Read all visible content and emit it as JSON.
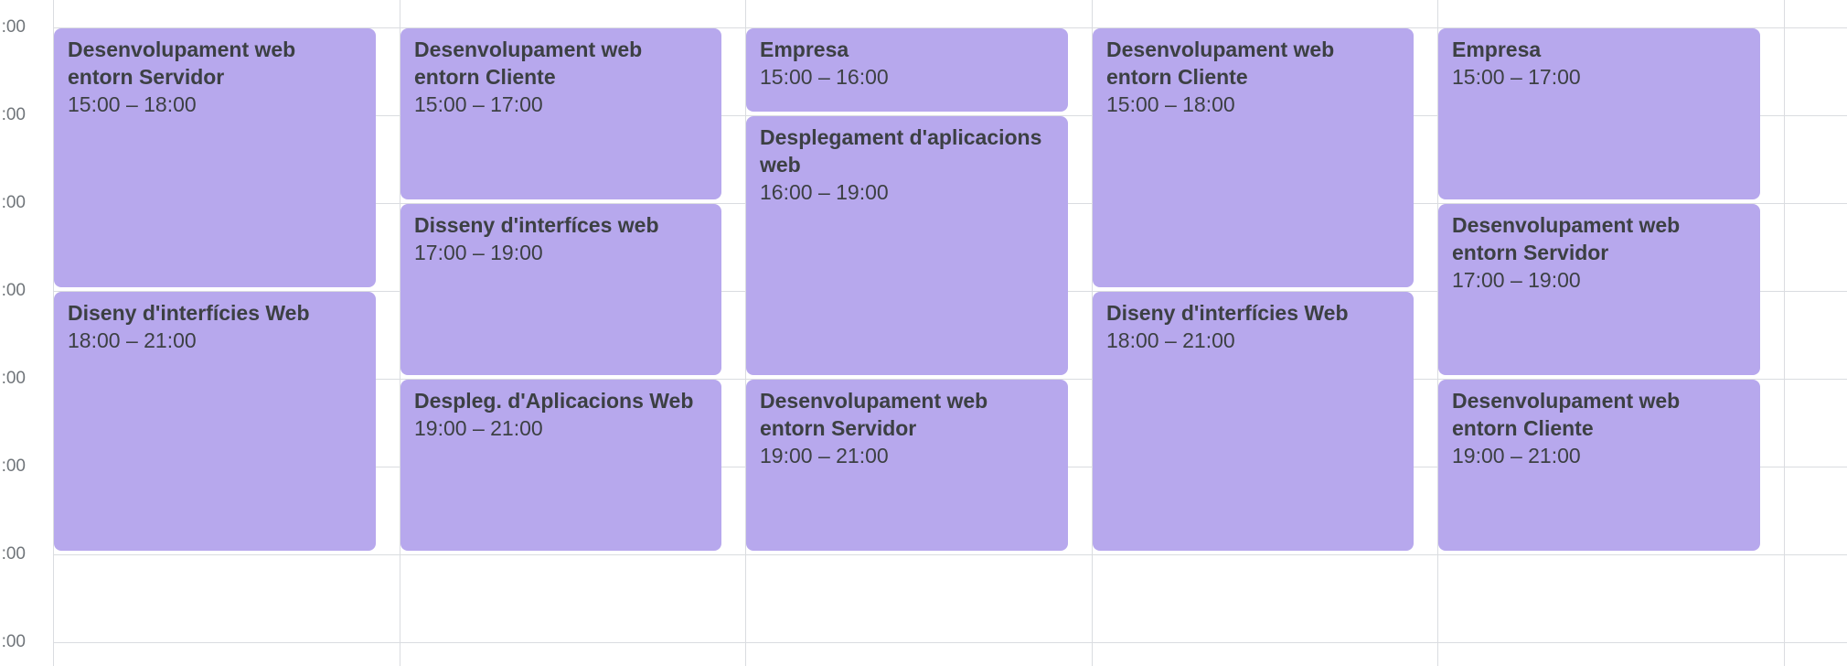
{
  "time_labels": [
    ":00",
    ":00",
    ":00",
    ":00",
    ":00",
    ":00",
    ":00",
    ":00"
  ],
  "event_color": "#b7a8ed",
  "events": [
    {
      "title": "Desenvolupament web entorn Servidor",
      "time": "15:00 – 18:00"
    },
    {
      "title": "Diseny d'interfícies Web",
      "time": "18:00 – 21:00"
    },
    {
      "title": "Desenvolupament web entorn Cliente",
      "time": "15:00 – 17:00"
    },
    {
      "title": "Disseny d'interfíces web",
      "time": "17:00 – 19:00"
    },
    {
      "title": "Despleg. d'Aplicacions Web",
      "time": "19:00 – 21:00"
    },
    {
      "title": "Empresa",
      "time": "15:00 – 16:00"
    },
    {
      "title": "Desplegament d'aplicacions web",
      "time": "16:00 – 19:00"
    },
    {
      "title": "Desenvolupament web entorn Servidor",
      "time": "19:00 – 21:00"
    },
    {
      "title": "Desenvolupament web entorn Cliente",
      "time": "15:00 – 18:00"
    },
    {
      "title": "Diseny d'interfícies Web",
      "time": "18:00 – 21:00"
    },
    {
      "title": "Empresa",
      "time": "15:00 – 17:00"
    },
    {
      "title": "Desenvolupament web entorn Servidor",
      "time": "17:00 – 19:00"
    },
    {
      "title": "Desenvolupament web entorn Cliente",
      "time": "19:00 – 21:00"
    }
  ]
}
